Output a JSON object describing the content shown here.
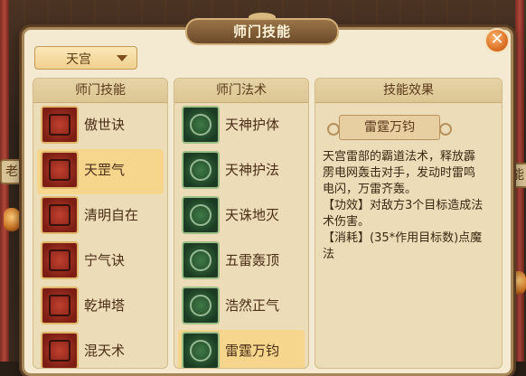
{
  "panel": {
    "title": "师门技能",
    "close_glyph": "✕"
  },
  "dropdown": {
    "selected": "天宫"
  },
  "skills_column": {
    "header": "师门技能",
    "items": [
      {
        "label": "傲世诀",
        "icon": "scroll-icon",
        "selected": false
      },
      {
        "label": "天罡气",
        "icon": "figure-icon",
        "selected": true
      },
      {
        "label": "清明自在",
        "icon": "bell-icon",
        "selected": false
      },
      {
        "label": "宁气诀",
        "icon": "ring-icon",
        "selected": false
      },
      {
        "label": "乾坤塔",
        "icon": "pagoda-icon",
        "selected": false
      },
      {
        "label": "混天术",
        "icon": "warrior-icon",
        "selected": false
      }
    ]
  },
  "spells_column": {
    "header": "师门法术",
    "items": [
      {
        "label": "天神护体",
        "icon": "shield-icon",
        "selected": false
      },
      {
        "label": "天神护法",
        "icon": "guardian-icon",
        "selected": false
      },
      {
        "label": "天诛地灭",
        "icon": "frame-icon",
        "selected": false
      },
      {
        "label": "五雷轰顶",
        "icon": "lightning-icon",
        "selected": false
      },
      {
        "label": "浩然正气",
        "icon": "cloud-icon",
        "selected": false
      },
      {
        "label": "雷霆万钧",
        "icon": "claw-icon",
        "selected": true
      }
    ]
  },
  "effect_column": {
    "header": "技能效果",
    "spell_name": "雷霆万钧",
    "description": "天宫雷部的霸道法术，释放霹雳电网轰击对手，发动时雷鸣电闪，万雷齐轰。",
    "effect_line": "【功效】对敌方3个目标造成法术伤害。",
    "cost_line": "【消耗】(35*作用目标数)点魔法"
  },
  "background": {
    "left_tab": "老",
    "right_tab": "能"
  },
  "colors": {
    "panel_bg": "#f4ead1",
    "selected_row": "#f6d58c",
    "frame_brown": "#a7865a",
    "close_orange": "#d66a20"
  }
}
